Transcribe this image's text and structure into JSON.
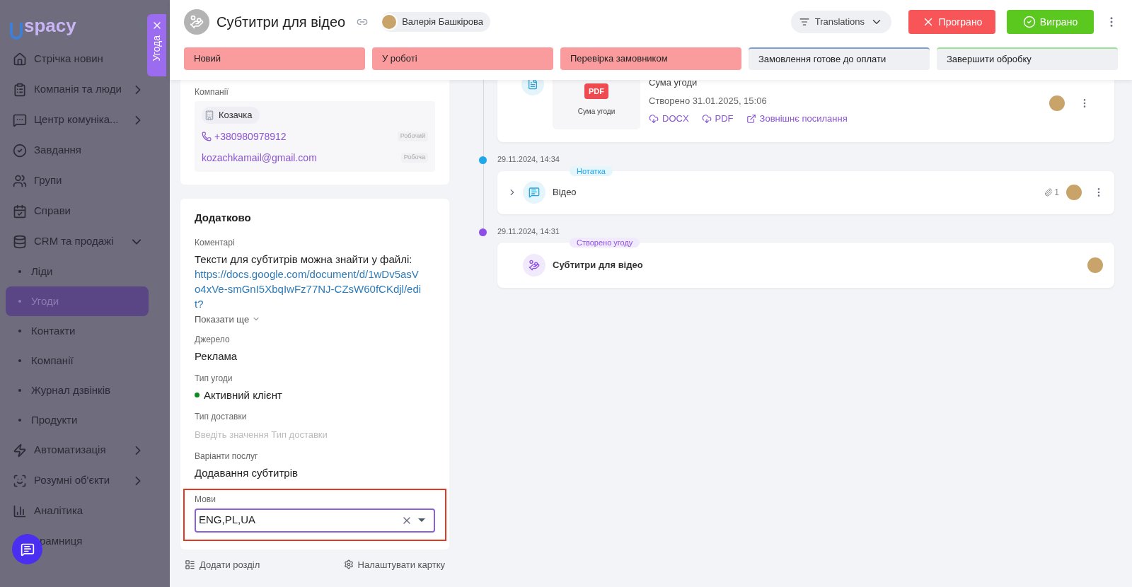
{
  "sidebar": {
    "logo": "spacy",
    "items": [
      {
        "label": "Стрічка новин",
        "selected": false
      },
      {
        "label": "Компанія та люди",
        "selected": false,
        "expanded": false
      },
      {
        "label": "Центр комуніка...",
        "selected": false,
        "expanded": false
      },
      {
        "label": "Завдання",
        "selected": false
      },
      {
        "label": "Групи",
        "selected": false
      },
      {
        "label": "Справи",
        "selected": false
      },
      {
        "label": "CRM та продажі",
        "selected": false,
        "expanded": true,
        "children": [
          {
            "label": "Ліди",
            "selected": false
          },
          {
            "label": "Угоди",
            "selected": true
          },
          {
            "label": "Контакти",
            "selected": false
          },
          {
            "label": "Компанії",
            "selected": false
          },
          {
            "label": "Журнал дзвінків",
            "selected": false
          },
          {
            "label": "Продукти",
            "selected": false
          }
        ]
      },
      {
        "label": "Автоматизація",
        "selected": false,
        "expanded": false
      },
      {
        "label": "Розумні об'єкти",
        "selected": false,
        "expanded": false
      },
      {
        "label": "Аналітика",
        "selected": false
      },
      {
        "label": "рамниця",
        "selected": false
      }
    ]
  },
  "drawer_tab": {
    "label": "Угода"
  },
  "header": {
    "title": "Субтитри для відео",
    "owner": "Валерія Башкірова",
    "pipeline": "Translations",
    "lose_button": "Програно",
    "win_button": "Виграно"
  },
  "stages": [
    {
      "label": "Новий",
      "done": true,
      "color": "#fa9c9e"
    },
    {
      "label": "У роботі",
      "done": true,
      "color": "#fa9c9e"
    },
    {
      "label": "Перевірка замовником",
      "done": true,
      "color": "#fa9c9e"
    },
    {
      "label": "Замовлення готове до оплати",
      "done": false,
      "color": "#7d9fd0"
    },
    {
      "label": "Завершити обробку",
      "done": false,
      "color": "#9be39a"
    }
  ],
  "companies": {
    "label": "Компанії",
    "name": "Козачка",
    "contacts": [
      {
        "kind": "phone",
        "value": "+380980978912",
        "tag": "Робочий"
      },
      {
        "kind": "email",
        "value": "kozachkamail@gmail.com",
        "tag": "Робоча"
      }
    ]
  },
  "extra": {
    "title": "Додатково",
    "comment_label": "Коментарі",
    "comment": "Тексти для субтитрів можна знайти у файлі:",
    "comment_link": "https://docs.google.com/document/d/1wDv5asVo4xVe-smGnI5XbqIwFz77NJ-CZsW60fCKdjl/edit?",
    "show_more": "Показати ще",
    "fields": [
      {
        "kind": "text",
        "label": "Джерело",
        "value": "Реклама"
      },
      {
        "kind": "status",
        "label": "Тип угоди",
        "value": "Активний клієнт",
        "color": "#0f8a1f"
      },
      {
        "kind": "empty",
        "label": "Тип доставки",
        "placeholder": "Введіть значення Тип доставки"
      },
      {
        "kind": "text",
        "label": "Варіанти послуг",
        "value": "Додавання субтитрів"
      },
      {
        "kind": "select",
        "label": "Мови",
        "value": "ENG,PL,UA"
      }
    ]
  },
  "footer": {
    "add_section": "Додати розділ",
    "configure": "Налаштувати картку"
  },
  "timeline": [
    {
      "kind": "document",
      "badge": "PDF",
      "caption": "Сума угоди",
      "title": "Сума угоди",
      "created": "Створено 31.01.2025, 15:06",
      "links": [
        "DOCX",
        "PDF",
        "Зовнішнє посилання"
      ]
    },
    {
      "kind": "note",
      "date": "29.11.2024, 14:34",
      "color": "#1ea7ea",
      "tag": "Нотатка",
      "title": "Відео",
      "attachments": "1"
    },
    {
      "kind": "deal",
      "date": "29.11.2024, 14:31",
      "color": "#8e4fe6",
      "tag": "Створено угоду",
      "title": "Субтитри для відео"
    }
  ]
}
